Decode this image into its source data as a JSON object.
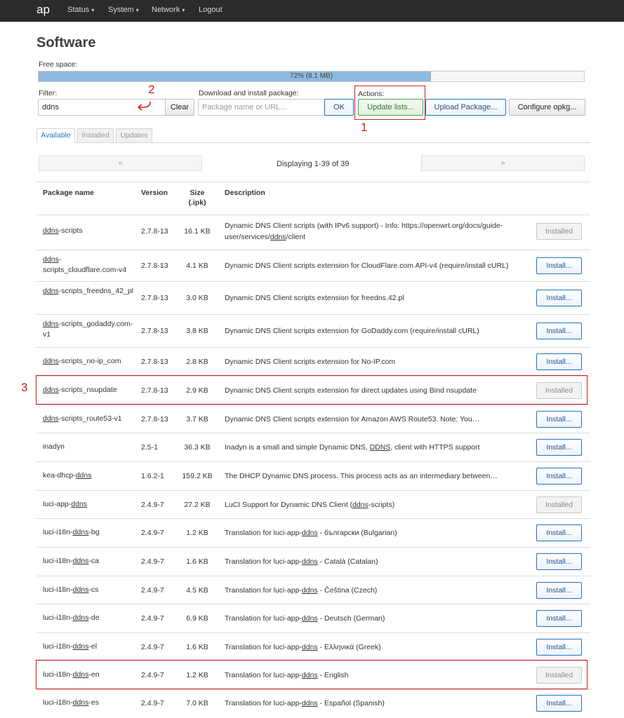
{
  "nav": {
    "brand": "ap",
    "items": [
      "Status",
      "System",
      "Network",
      "Logout"
    ],
    "caret": "▾"
  },
  "page": {
    "title": "Software"
  },
  "free_space": {
    "label": "Free space:",
    "percent": 72,
    "text": "72% (8.1 MB)"
  },
  "filter": {
    "label": "Filter:",
    "value": "ddns",
    "clear_label": "Clear"
  },
  "download": {
    "label": "Download and install package:",
    "placeholder": "Package name or URL...",
    "ok_label": "OK"
  },
  "actions": {
    "label": "Actions:",
    "update_lists": "Update lists...",
    "upload_package": "Upload Package...",
    "configure_opkg": "Configure opkg..."
  },
  "annotations": [
    "1",
    "2",
    "3"
  ],
  "tabs": [
    "Available",
    "Installed",
    "Updates"
  ],
  "pager": {
    "prev": "«",
    "next": "»",
    "status": "Displaying 1-39 of 39"
  },
  "table": {
    "headers": [
      "Package name",
      "Version",
      "Size\n(.ipk)",
      "Description"
    ],
    "rows": [
      {
        "name": [
          "ddns",
          "-scripts"
        ],
        "version": "2.7.8-13",
        "size": "16.1 KB",
        "desc": [
          "Dynamic DNS Client scripts (with IPv6 support) - Info: https://openwrt.org/docs/guide-user/services/",
          "ddns",
          "/client"
        ],
        "action": "Installed"
      },
      {
        "name": [
          "ddns",
          "-scripts_cloudflare.com-v4"
        ],
        "version": "2.7.8-13",
        "size": "4.1 KB",
        "desc": [
          "Dynamic DNS Client scripts extension for CloudFlare.com API-v4 (require/install cURL)"
        ],
        "action": "Install..."
      },
      {
        "name": [
          "ddns",
          "-scripts_freedns_42_pl"
        ],
        "version": "2.7.8-13",
        "size": "3.0 KB",
        "desc": [
          "Dynamic DNS Client scripts extension for freedns.42.pl"
        ],
        "action": "Install..."
      },
      {
        "name": [
          "ddns",
          "-scripts_godaddy.com-v1"
        ],
        "version": "2.7.8-13",
        "size": "3.8 KB",
        "desc": [
          "Dynamic DNS Client scripts extension for GoDaddy.com (require/install cURL)"
        ],
        "action": "Install..."
      },
      {
        "name": [
          "ddns",
          "-scripts_no-ip_com"
        ],
        "version": "2.7.8-13",
        "size": "2.8 KB",
        "desc": [
          "Dynamic DNS Client scripts extension for No-IP.com"
        ],
        "action": "Install..."
      },
      {
        "name": [
          "ddns",
          "-scripts_nsupdate"
        ],
        "version": "2.7.8-13",
        "size": "2.9 KB",
        "desc": [
          "Dynamic DNS Client scripts extension for direct updates using Bind nsupdate"
        ],
        "action": "Installed"
      },
      {
        "name": [
          "ddns",
          "-scripts_route53-v1"
        ],
        "version": "2.7.8-13",
        "size": "3.7 KB",
        "desc": [
          "Dynamic DNS Client scripts extension for Amazon AWS Route53. Note: You…"
        ],
        "action": "Install..."
      },
      {
        "name": [
          "",
          "inadyn"
        ],
        "version": "2.5-1",
        "size": "36.3 KB",
        "desc": [
          "Inadyn is a small and simple Dynamic DNS, ",
          "DDNS",
          ", client with HTTPS support"
        ],
        "action": "Install..."
      },
      {
        "name": [
          "kea-dhcp-",
          "ddns"
        ],
        "version": "1.6.2-1",
        "size": "159.2 KB",
        "desc": [
          "The DHCP Dynamic DNS process. This process acts as an intermediary between…"
        ],
        "action": "Install..."
      },
      {
        "name": [
          "luci-app-",
          "ddns"
        ],
        "version": "2.4.9-7",
        "size": "27.2 KB",
        "desc": [
          "LuCI Support for Dynamic DNS Client (",
          "ddns",
          "-scripts)"
        ],
        "action": "Installed"
      },
      {
        "name": [
          "luci-i18n-",
          "ddns",
          "-bg"
        ],
        "version": "2.4.9-7",
        "size": "1.2 KB",
        "desc": [
          "Translation for luci-app-",
          "ddns",
          " - български (Bulgarian)"
        ],
        "action": "Install..."
      },
      {
        "name": [
          "luci-i18n-",
          "ddns",
          "-ca"
        ],
        "version": "2.4.9-7",
        "size": "1.6 KB",
        "desc": [
          "Translation for luci-app-",
          "ddns",
          " - Català (Catalan)"
        ],
        "action": "Install..."
      },
      {
        "name": [
          "luci-i18n-",
          "ddns",
          "-cs"
        ],
        "version": "2.4.9-7",
        "size": "4.5 KB",
        "desc": [
          "Translation for luci-app-",
          "ddns",
          " - Čeština (Czech)"
        ],
        "action": "Install..."
      },
      {
        "name": [
          "luci-i18n-",
          "ddns",
          "-de"
        ],
        "version": "2.4.9-7",
        "size": "6.9 KB",
        "desc": [
          "Translation for luci-app-",
          "ddns",
          " - Deutsch (German)"
        ],
        "action": "Install..."
      },
      {
        "name": [
          "luci-i18n-",
          "ddns",
          "-el"
        ],
        "version": "2.4.9-7",
        "size": "1.6 KB",
        "desc": [
          "Translation for luci-app-",
          "ddns",
          " - Ελληνικά (Greek)"
        ],
        "action": "Install..."
      },
      {
        "name": [
          "luci-i18n-",
          "ddns",
          "-en"
        ],
        "version": "2.4.9-7",
        "size": "1.2 KB",
        "desc": [
          "Translation for luci-app-",
          "ddns",
          " - English"
        ],
        "action": "Installed"
      },
      {
        "name": [
          "luci-i18n-",
          "ddns",
          "-es"
        ],
        "version": "2.4.9-7",
        "size": "7.0 KB",
        "desc": [
          "Translation for luci-app-",
          "ddns",
          " - Español (Spanish)"
        ],
        "action": "Install..."
      }
    ]
  }
}
